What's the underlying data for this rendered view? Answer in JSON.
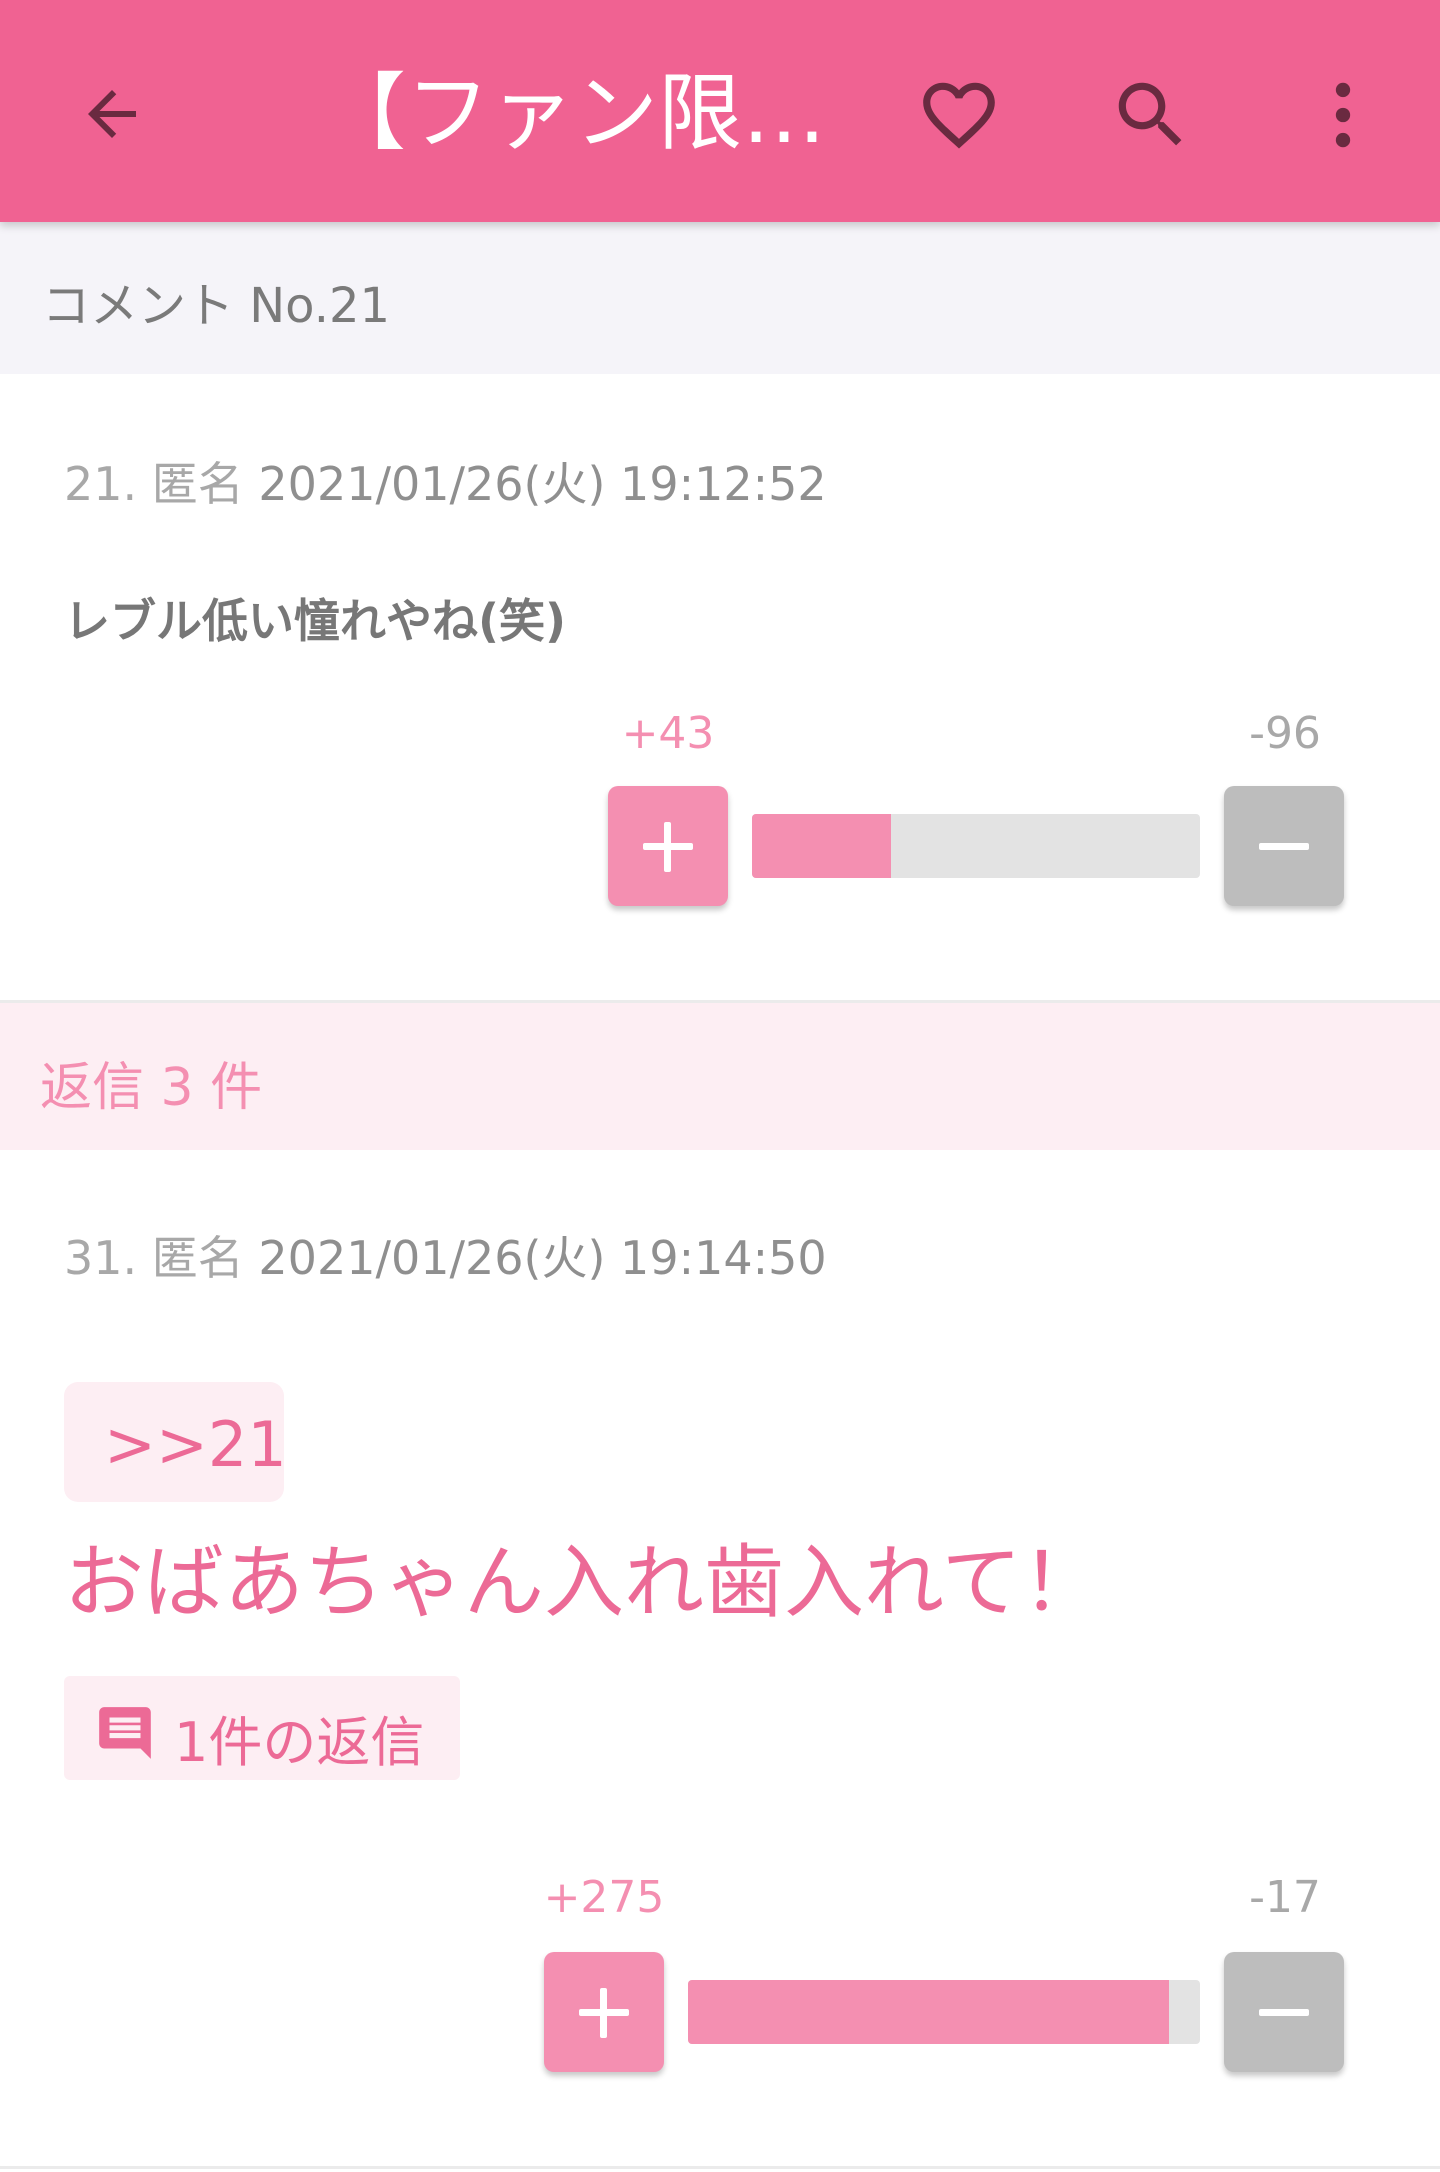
{
  "app_bar": {
    "title": "【ファン限定...",
    "icons": [
      "back-arrow-icon",
      "heart-outline-icon",
      "search-icon",
      "more-vert-icon"
    ],
    "background": "#f06292"
  },
  "section_header": {
    "label": "コメント No.21"
  },
  "comment": {
    "number": "21.",
    "author": "匿名",
    "datetime": "2021/01/26(火) 19:12:52",
    "text": "レブル低い憧れやね(笑)",
    "plus_score": "+43",
    "minus_score": "-96",
    "plus_ratio": 0.31
  },
  "replies_header": {
    "label": "返信 3 件"
  },
  "reply": {
    "number": "31.",
    "author": "匿名",
    "datetime": "2021/01/26(火) 19:14:50",
    "anchor": ">>21",
    "text": "おばあちゃん入れ歯入れて！",
    "reply_count_label": "1件の返信",
    "plus_score": "+275",
    "minus_score": "-17",
    "plus_ratio": 0.94
  },
  "colors": {
    "accent_pink": "#f06292",
    "light_pink": "#f48fb1",
    "pale_pink": "#fdeef3",
    "minus_gray": "#bdbdbd"
  }
}
